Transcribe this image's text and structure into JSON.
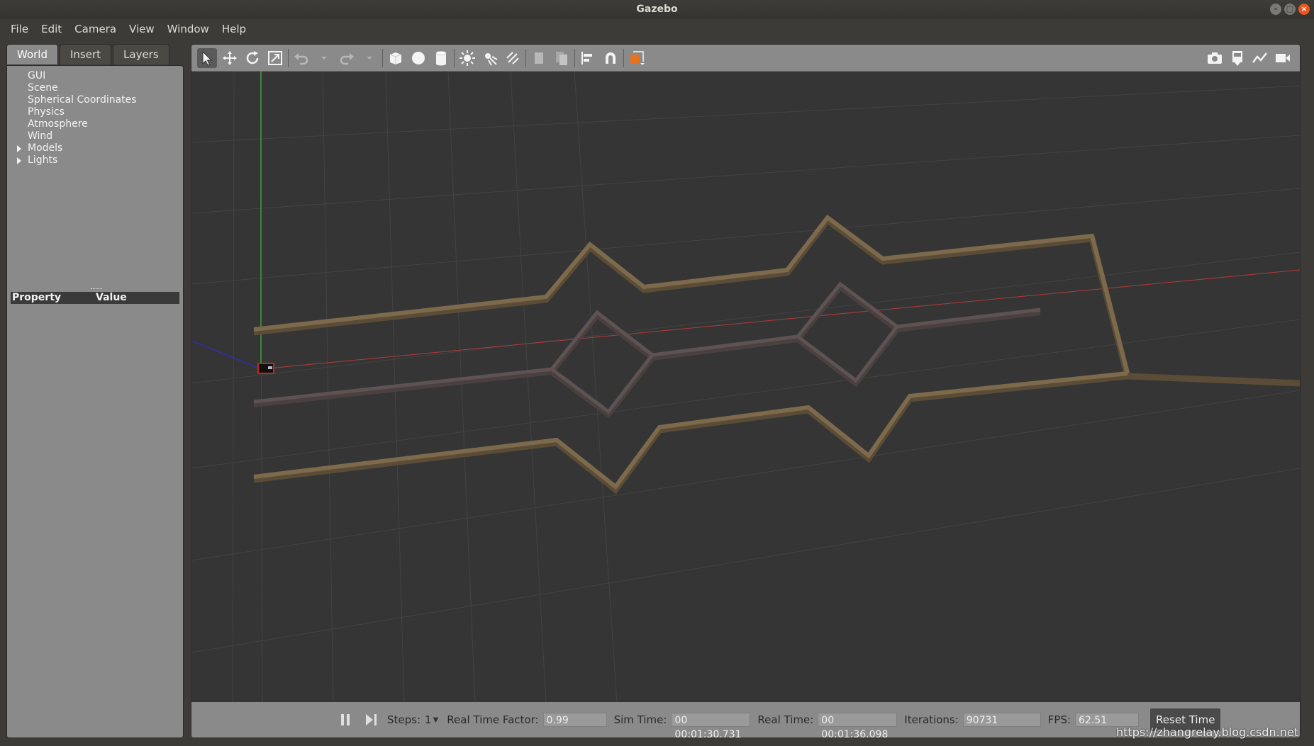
{
  "window": {
    "title": "Gazebo",
    "controls": {
      "minimize": "–",
      "maximize": "□",
      "close": "×"
    }
  },
  "menu": [
    "File",
    "Edit",
    "Camera",
    "View",
    "Window",
    "Help"
  ],
  "left_panel": {
    "tabs": [
      "World",
      "Insert",
      "Layers"
    ],
    "active_tab": "World",
    "tree": [
      {
        "label": "GUI",
        "expandable": false
      },
      {
        "label": "Scene",
        "expandable": false
      },
      {
        "label": "Spherical Coordinates",
        "expandable": false
      },
      {
        "label": "Physics",
        "expandable": false
      },
      {
        "label": "Atmosphere",
        "expandable": false
      },
      {
        "label": "Wind",
        "expandable": false
      },
      {
        "label": "Models",
        "expandable": true
      },
      {
        "label": "Lights",
        "expandable": true
      }
    ],
    "property_header": {
      "property": "Property",
      "value": "Value"
    }
  },
  "toolbar": {
    "left_icons": [
      "select-arrow-icon",
      "translate-icon",
      "rotate-icon",
      "scale-icon",
      "undo-icon",
      "undo-dropdown-icon",
      "redo-icon",
      "redo-dropdown-icon",
      "box-shape-icon",
      "sphere-shape-icon",
      "cylinder-shape-icon",
      "point-light-icon",
      "spot-light-icon",
      "directional-light-icon",
      "copy-icon",
      "paste-icon",
      "align-icon",
      "snap-magnet-icon",
      "view-angle-icon"
    ],
    "right_icons": [
      "screenshot-camera-icon",
      "log-icon",
      "plot-icon",
      "video-record-icon"
    ]
  },
  "status": {
    "steps_label": "Steps:",
    "steps_value": "1",
    "rtf_label": "Real Time Factor:",
    "rtf_value": "0.99",
    "sim_time_label": "Sim Time:",
    "sim_time_value": "00 00:01:30.731",
    "real_time_label": "Real Time:",
    "real_time_value": "00 00:01:36.098",
    "iterations_label": "Iterations:",
    "iterations_value": "90731",
    "fps_label": "FPS:",
    "fps_value": "62.51",
    "reset_label": "Reset Time"
  },
  "colors": {
    "outer_wall": "#7d6a4d",
    "inner_wall": "#5e5252",
    "viewport_bg": "#353535",
    "axis_x": "#b33a3a",
    "axis_y": "#3aa03a",
    "axis_z": "#2f2fb0"
  },
  "watermark": "https://zhangrelay.blog.csdn.net"
}
